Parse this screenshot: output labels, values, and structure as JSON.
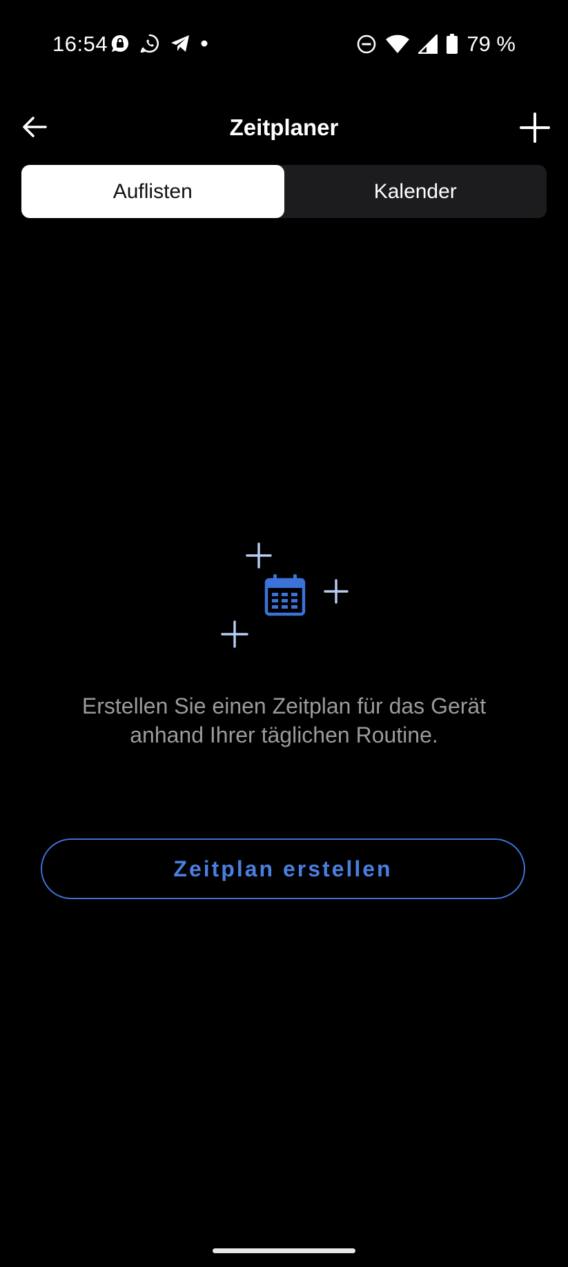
{
  "status_bar": {
    "time": "16:54",
    "battery_text": "79 %",
    "left_icons": [
      "signal-message-icon",
      "whatsapp-icon",
      "telegram-icon",
      "notification-dot-icon"
    ],
    "right_icons": [
      "do-not-disturb-icon",
      "wifi-icon",
      "cell-signal-icon",
      "battery-icon"
    ]
  },
  "app_bar": {
    "title": "Zeitplaner",
    "back_icon": "arrow-left-icon",
    "add_icon": "plus-icon"
  },
  "tabs": [
    {
      "label": "Auflisten",
      "active": true
    },
    {
      "label": "Kalender",
      "active": false
    }
  ],
  "empty_state": {
    "icon": "calendar-icon",
    "message_line1": "Erstellen Sie einen Zeitplan für das Gerät",
    "message_line2": "anhand Ihrer täglichen Routine."
  },
  "create_button": {
    "label": "Zeitplan erstellen"
  },
  "colors": {
    "background": "#000000",
    "accent": "#3d72d8",
    "sparkle": "#b9cdf3",
    "tab_track": "#1c1c1e",
    "message_text": "#9b9b9b"
  }
}
